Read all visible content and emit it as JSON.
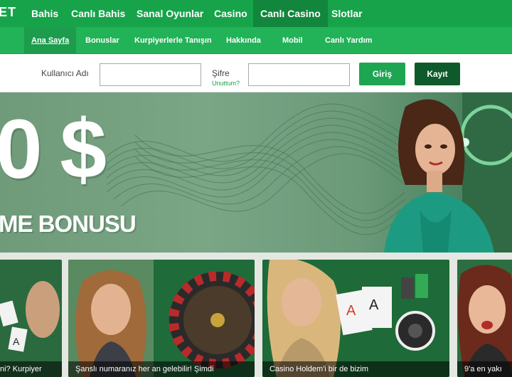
{
  "brand": "ET",
  "top_nav": [
    "Bahis",
    "Canlı Bahis",
    "Sanal Oyunlar",
    "Casino",
    "Canlı Casino",
    "Slotlar"
  ],
  "top_nav_active": "Canlı Casino",
  "sub_nav": [
    "Ana Sayfa",
    "Bonuslar",
    "Kurpiyerlerle Tanışın",
    "Hakkında",
    "Mobil",
    "Canlı Yardım"
  ],
  "sub_nav_active": "Ana Sayfa",
  "login": {
    "username_label": "Kullanıcı Adı",
    "password_label": "Şifre",
    "forgot_label": "Unuttum?",
    "login_button": "Giriş",
    "register_button": "Kayıt"
  },
  "hero": {
    "amount": "0 $",
    "subtitle": "ME BONUSU"
  },
  "tiles": [
    {
      "caption": "ni? Kurpiyer"
    },
    {
      "caption": "Şanslı numaranız her an gelebilir! Şimdi"
    },
    {
      "caption": "Casino Holdem'i bir de bizim"
    },
    {
      "caption": "9'a en yakı"
    }
  ],
  "colors": {
    "top_nav": "#16a34a",
    "sub_nav": "#22b257",
    "login_button": "#1ea552",
    "register_button": "#0f5a2a"
  }
}
